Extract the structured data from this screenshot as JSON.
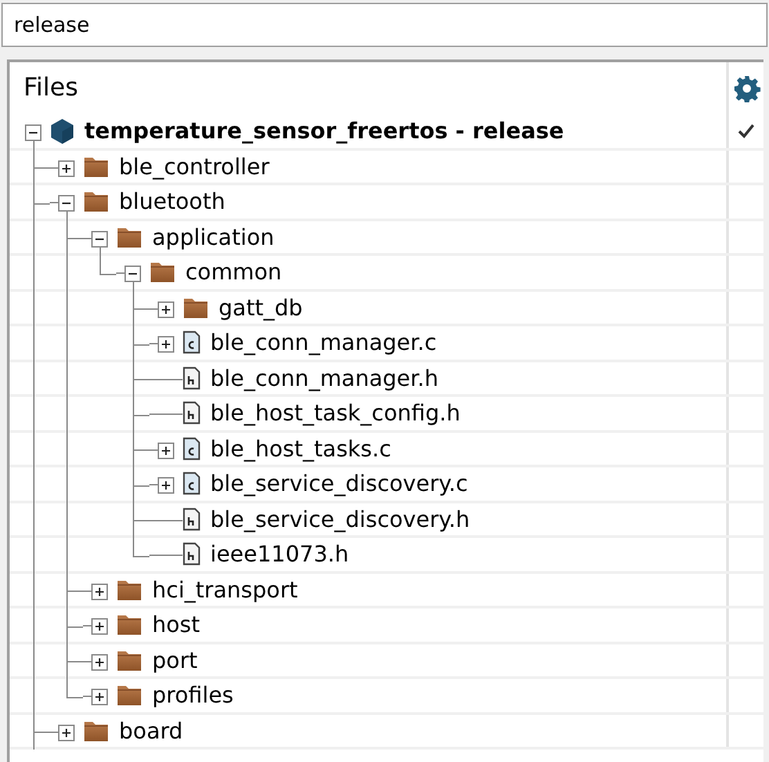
{
  "search": {
    "value": "release"
  },
  "tree": {
    "header": "Files",
    "root": {
      "label": "temperature_sensor_freertos - release",
      "kind": "project",
      "expandable": true,
      "expanded": true,
      "checked": true,
      "more_below": true,
      "children": [
        {
          "label": "ble_controller",
          "kind": "folder",
          "expandable": true,
          "expanded": false,
          "checked": false
        },
        {
          "label": "bluetooth",
          "kind": "folder",
          "expandable": true,
          "expanded": true,
          "checked": false,
          "children": [
            {
              "label": "application",
              "kind": "folder",
              "expandable": true,
              "expanded": true,
              "checked": false,
              "children": [
                {
                  "label": "common",
                  "kind": "folder",
                  "expandable": true,
                  "expanded": true,
                  "checked": false,
                  "children": [
                    {
                      "label": "gatt_db",
                      "kind": "folder",
                      "expandable": true,
                      "expanded": false,
                      "checked": false
                    },
                    {
                      "label": "ble_conn_manager.c",
                      "kind": "source",
                      "expandable": true,
                      "expanded": false,
                      "checked": false
                    },
                    {
                      "label": "ble_conn_manager.h",
                      "kind": "header",
                      "expandable": false,
                      "checked": false
                    },
                    {
                      "label": "ble_host_task_config.h",
                      "kind": "header",
                      "expandable": false,
                      "checked": false
                    },
                    {
                      "label": "ble_host_tasks.c",
                      "kind": "source",
                      "expandable": true,
                      "expanded": false,
                      "checked": false
                    },
                    {
                      "label": "ble_service_discovery.c",
                      "kind": "source",
                      "expandable": true,
                      "expanded": false,
                      "checked": false
                    },
                    {
                      "label": "ble_service_discovery.h",
                      "kind": "header",
                      "expandable": false,
                      "checked": false
                    },
                    {
                      "label": "ieee11073.h",
                      "kind": "header",
                      "expandable": false,
                      "checked": false
                    }
                  ]
                }
              ]
            },
            {
              "label": "hci_transport",
              "kind": "folder",
              "expandable": true,
              "expanded": false,
              "checked": false
            },
            {
              "label": "host",
              "kind": "folder",
              "expandable": true,
              "expanded": false,
              "checked": false
            },
            {
              "label": "port",
              "kind": "folder",
              "expandable": true,
              "expanded": false,
              "checked": false
            },
            {
              "label": "profiles",
              "kind": "folder",
              "expandable": true,
              "expanded": false,
              "checked": false
            }
          ]
        },
        {
          "label": "board",
          "kind": "folder",
          "expandable": true,
          "expanded": false,
          "checked": false
        }
      ]
    }
  }
}
